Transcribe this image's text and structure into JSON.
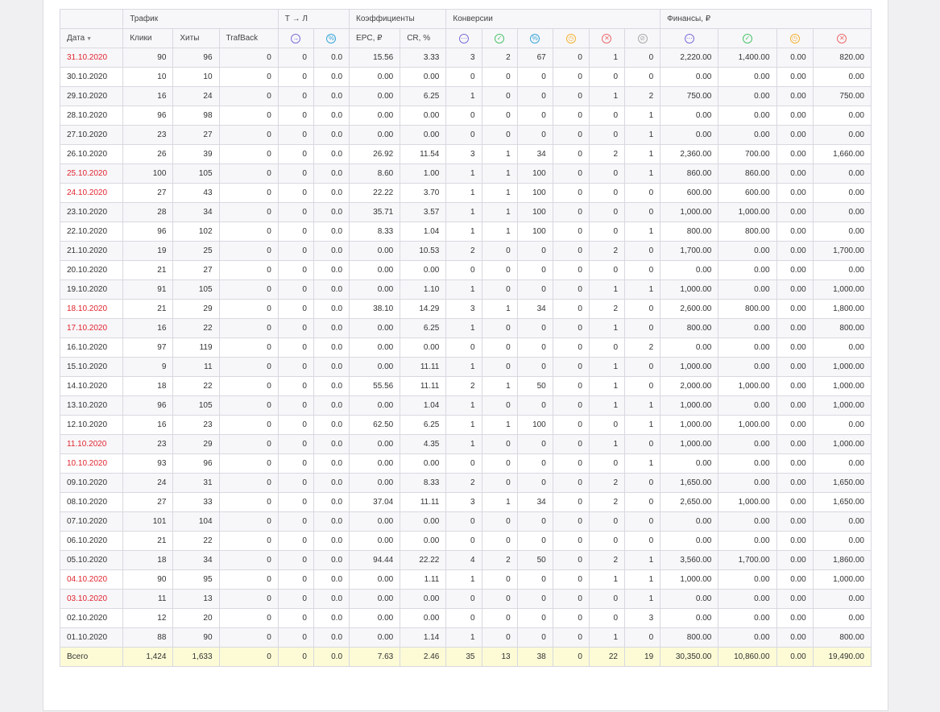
{
  "headers": {
    "groups": {
      "traffic": "Трафик",
      "tl": "Т → Л",
      "coeff": "Коэффициенты",
      "conv": "Конверсии",
      "fin": "Финансы, ₽"
    },
    "columns": {
      "date": "Дата",
      "clicks": "Клики",
      "hits": "Хиты",
      "trafback": "TrafBack",
      "epc": "EPC, ₽",
      "cr": "CR, %"
    },
    "icons": {
      "tl_arrow": "→",
      "tl_percent": "%",
      "conv_all": "⋯",
      "conv_ok": "✓",
      "conv_pct": "%",
      "conv_hold": "◷",
      "conv_rej": "✕",
      "conv_trash": "⊘",
      "fin_all": "⋯",
      "fin_ok": "✓",
      "fin_hold": "◷",
      "fin_rej": "✕"
    }
  },
  "colors": {
    "icon_purple": "#7a6fd6",
    "icon_green": "#4cc36a",
    "icon_blue": "#3ba6d8",
    "icon_orange": "#f5b335",
    "icon_red": "#ec6a6a",
    "icon_gray": "#aaaaaa",
    "date_red": "#e0242e",
    "link_blue": "#3ba6d8",
    "total_bg": "#fcfbd6"
  },
  "rows": [
    {
      "date": "31.10.2020",
      "red": true,
      "clicks": "90",
      "hits": "96",
      "trafback": "0",
      "tl1": "0",
      "tl2": "0.0",
      "epc": "15.56",
      "cr": "3.33",
      "c_all": "3",
      "c_ok": "2",
      "c_pct": "67",
      "c_hold": "0",
      "c_rej": "1",
      "c_trash": "0",
      "f_all": "2,220.00",
      "f_ok": "1,400.00",
      "f_hold": "0.00",
      "f_rej": "820.00"
    },
    {
      "date": "30.10.2020",
      "red": false,
      "clicks": "10",
      "hits": "10",
      "trafback": "0",
      "tl1": "0",
      "tl2": "0.0",
      "epc": "0.00",
      "cr": "0.00",
      "c_all": "0",
      "c_ok": "0",
      "c_pct": "0",
      "c_hold": "0",
      "c_rej": "0",
      "c_trash": "0",
      "f_all": "0.00",
      "f_ok": "0.00",
      "f_hold": "0.00",
      "f_rej": "0.00"
    },
    {
      "date": "29.10.2020",
      "red": false,
      "clicks": "16",
      "hits": "24",
      "trafback": "0",
      "tl1": "0",
      "tl2": "0.0",
      "epc": "0.00",
      "cr": "6.25",
      "c_all": "1",
      "c_ok": "0",
      "c_pct": "0",
      "c_hold": "0",
      "c_rej": "1",
      "c_trash": "2",
      "f_all": "750.00",
      "f_ok": "0.00",
      "f_hold": "0.00",
      "f_rej": "750.00"
    },
    {
      "date": "28.10.2020",
      "red": false,
      "clicks": "96",
      "hits": "98",
      "trafback": "0",
      "tl1": "0",
      "tl2": "0.0",
      "epc": "0.00",
      "cr": "0.00",
      "c_all": "0",
      "c_ok": "0",
      "c_pct": "0",
      "c_hold": "0",
      "c_rej": "0",
      "c_trash": "1",
      "f_all": "0.00",
      "f_ok": "0.00",
      "f_hold": "0.00",
      "f_rej": "0.00"
    },
    {
      "date": "27.10.2020",
      "red": false,
      "clicks": "23",
      "hits": "27",
      "trafback": "0",
      "tl1": "0",
      "tl2": "0.0",
      "epc": "0.00",
      "cr": "0.00",
      "c_all": "0",
      "c_ok": "0",
      "c_pct": "0",
      "c_hold": "0",
      "c_rej": "0",
      "c_trash": "1",
      "f_all": "0.00",
      "f_ok": "0.00",
      "f_hold": "0.00",
      "f_rej": "0.00"
    },
    {
      "date": "26.10.2020",
      "red": false,
      "clicks": "26",
      "hits": "39",
      "trafback": "0",
      "tl1": "0",
      "tl2": "0.0",
      "epc": "26.92",
      "cr": "11.54",
      "c_all": "3",
      "c_ok": "1",
      "c_pct": "34",
      "c_hold": "0",
      "c_rej": "2",
      "c_trash": "1",
      "f_all": "2,360.00",
      "f_ok": "700.00",
      "f_hold": "0.00",
      "f_rej": "1,660.00"
    },
    {
      "date": "25.10.2020",
      "red": true,
      "clicks": "100",
      "hits": "105",
      "trafback": "0",
      "tl1": "0",
      "tl2": "0.0",
      "epc": "8.60",
      "cr": "1.00",
      "c_all": "1",
      "c_ok": "1",
      "c_pct": "100",
      "c_hold": "0",
      "c_rej": "0",
      "c_trash": "1",
      "f_all": "860.00",
      "f_ok": "860.00",
      "f_hold": "0.00",
      "f_rej": "0.00"
    },
    {
      "date": "24.10.2020",
      "red": true,
      "clicks": "27",
      "hits": "43",
      "trafback": "0",
      "tl1": "0",
      "tl2": "0.0",
      "epc": "22.22",
      "cr": "3.70",
      "c_all": "1",
      "c_ok": "1",
      "c_pct": "100",
      "c_hold": "0",
      "c_rej": "0",
      "c_trash": "0",
      "f_all": "600.00",
      "f_ok": "600.00",
      "f_hold": "0.00",
      "f_rej": "0.00"
    },
    {
      "date": "23.10.2020",
      "red": false,
      "clicks": "28",
      "hits": "34",
      "trafback": "0",
      "tl1": "0",
      "tl2": "0.0",
      "epc": "35.71",
      "cr": "3.57",
      "c_all": "1",
      "c_ok": "1",
      "c_pct": "100",
      "c_hold": "0",
      "c_rej": "0",
      "c_trash": "0",
      "f_all": "1,000.00",
      "f_ok": "1,000.00",
      "f_hold": "0.00",
      "f_rej": "0.00"
    },
    {
      "date": "22.10.2020",
      "red": false,
      "clicks": "96",
      "hits": "102",
      "trafback": "0",
      "tl1": "0",
      "tl2": "0.0",
      "epc": "8.33",
      "cr": "1.04",
      "c_all": "1",
      "c_ok": "1",
      "c_pct": "100",
      "c_hold": "0",
      "c_rej": "0",
      "c_trash": "1",
      "f_all": "800.00",
      "f_ok": "800.00",
      "f_hold": "0.00",
      "f_rej": "0.00"
    },
    {
      "date": "21.10.2020",
      "red": false,
      "clicks": "19",
      "hits": "25",
      "trafback": "0",
      "tl1": "0",
      "tl2": "0.0",
      "epc": "0.00",
      "cr": "10.53",
      "c_all": "2",
      "c_ok": "0",
      "c_pct": "0",
      "c_hold": "0",
      "c_rej": "2",
      "c_trash": "0",
      "f_all": "1,700.00",
      "f_ok": "0.00",
      "f_hold": "0.00",
      "f_rej": "1,700.00"
    },
    {
      "date": "20.10.2020",
      "red": false,
      "clicks": "21",
      "hits": "27",
      "trafback": "0",
      "tl1": "0",
      "tl2": "0.0",
      "epc": "0.00",
      "cr": "0.00",
      "c_all": "0",
      "c_ok": "0",
      "c_pct": "0",
      "c_hold": "0",
      "c_rej": "0",
      "c_trash": "0",
      "f_all": "0.00",
      "f_ok": "0.00",
      "f_hold": "0.00",
      "f_rej": "0.00"
    },
    {
      "date": "19.10.2020",
      "red": false,
      "clicks": "91",
      "hits": "105",
      "trafback": "0",
      "tl1": "0",
      "tl2": "0.0",
      "epc": "0.00",
      "cr": "1.10",
      "c_all": "1",
      "c_ok": "0",
      "c_pct": "0",
      "c_hold": "0",
      "c_rej": "1",
      "c_trash": "1",
      "f_all": "1,000.00",
      "f_ok": "0.00",
      "f_hold": "0.00",
      "f_rej": "1,000.00"
    },
    {
      "date": "18.10.2020",
      "red": true,
      "clicks": "21",
      "hits": "29",
      "trafback": "0",
      "tl1": "0",
      "tl2": "0.0",
      "epc": "38.10",
      "cr": "14.29",
      "c_all": "3",
      "c_ok": "1",
      "c_pct": "34",
      "c_hold": "0",
      "c_rej": "2",
      "c_trash": "0",
      "f_all": "2,600.00",
      "f_ok": "800.00",
      "f_hold": "0.00",
      "f_rej": "1,800.00"
    },
    {
      "date": "17.10.2020",
      "red": true,
      "clicks": "16",
      "hits": "22",
      "trafback": "0",
      "tl1": "0",
      "tl2": "0.0",
      "epc": "0.00",
      "cr": "6.25",
      "c_all": "1",
      "c_ok": "0",
      "c_pct": "0",
      "c_hold": "0",
      "c_rej": "1",
      "c_trash": "0",
      "f_all": "800.00",
      "f_ok": "0.00",
      "f_hold": "0.00",
      "f_rej": "800.00"
    },
    {
      "date": "16.10.2020",
      "red": false,
      "clicks": "97",
      "hits": "119",
      "trafback": "0",
      "tl1": "0",
      "tl2": "0.0",
      "epc": "0.00",
      "cr": "0.00",
      "c_all": "0",
      "c_ok": "0",
      "c_pct": "0",
      "c_hold": "0",
      "c_rej": "0",
      "c_trash": "2",
      "f_all": "0.00",
      "f_ok": "0.00",
      "f_hold": "0.00",
      "f_rej": "0.00"
    },
    {
      "date": "15.10.2020",
      "red": false,
      "clicks": "9",
      "hits": "11",
      "trafback": "0",
      "tl1": "0",
      "tl2": "0.0",
      "epc": "0.00",
      "cr": "11.11",
      "c_all": "1",
      "c_ok": "0",
      "c_pct": "0",
      "c_hold": "0",
      "c_rej": "1",
      "c_trash": "0",
      "f_all": "1,000.00",
      "f_ok": "0.00",
      "f_hold": "0.00",
      "f_rej": "1,000.00"
    },
    {
      "date": "14.10.2020",
      "red": false,
      "clicks": "18",
      "hits": "22",
      "trafback": "0",
      "tl1": "0",
      "tl2": "0.0",
      "epc": "55.56",
      "cr": "11.11",
      "c_all": "2",
      "c_ok": "1",
      "c_pct": "50",
      "c_hold": "0",
      "c_rej": "1",
      "c_trash": "0",
      "f_all": "2,000.00",
      "f_ok": "1,000.00",
      "f_hold": "0.00",
      "f_rej": "1,000.00"
    },
    {
      "date": "13.10.2020",
      "red": false,
      "clicks": "96",
      "hits": "105",
      "trafback": "0",
      "tl1": "0",
      "tl2": "0.0",
      "epc": "0.00",
      "cr": "1.04",
      "c_all": "1",
      "c_ok": "0",
      "c_pct": "0",
      "c_hold": "0",
      "c_rej": "1",
      "c_trash": "1",
      "f_all": "1,000.00",
      "f_ok": "0.00",
      "f_hold": "0.00",
      "f_rej": "1,000.00"
    },
    {
      "date": "12.10.2020",
      "red": false,
      "clicks": "16",
      "hits": "23",
      "trafback": "0",
      "tl1": "0",
      "tl2": "0.0",
      "epc": "62.50",
      "cr": "6.25",
      "c_all": "1",
      "c_ok": "1",
      "c_pct": "100",
      "c_hold": "0",
      "c_rej": "0",
      "c_trash": "1",
      "f_all": "1,000.00",
      "f_ok": "1,000.00",
      "f_hold": "0.00",
      "f_rej": "0.00"
    },
    {
      "date": "11.10.2020",
      "red": true,
      "clicks": "23",
      "hits": "29",
      "trafback": "0",
      "tl1": "0",
      "tl2": "0.0",
      "epc": "0.00",
      "cr": "4.35",
      "c_all": "1",
      "c_ok": "0",
      "c_pct": "0",
      "c_hold": "0",
      "c_rej": "1",
      "c_trash": "0",
      "f_all": "1,000.00",
      "f_ok": "0.00",
      "f_hold": "0.00",
      "f_rej": "1,000.00"
    },
    {
      "date": "10.10.2020",
      "red": true,
      "clicks": "93",
      "hits": "96",
      "trafback": "0",
      "tl1": "0",
      "tl2": "0.0",
      "epc": "0.00",
      "cr": "0.00",
      "c_all": "0",
      "c_ok": "0",
      "c_pct": "0",
      "c_hold": "0",
      "c_rej": "0",
      "c_trash": "1",
      "f_all": "0.00",
      "f_ok": "0.00",
      "f_hold": "0.00",
      "f_rej": "0.00"
    },
    {
      "date": "09.10.2020",
      "red": false,
      "clicks": "24",
      "hits": "31",
      "trafback": "0",
      "tl1": "0",
      "tl2": "0.0",
      "epc": "0.00",
      "cr": "8.33",
      "c_all": "2",
      "c_ok": "0",
      "c_pct": "0",
      "c_hold": "0",
      "c_rej": "2",
      "c_trash": "0",
      "f_all": "1,650.00",
      "f_ok": "0.00",
      "f_hold": "0.00",
      "f_rej": "1,650.00"
    },
    {
      "date": "08.10.2020",
      "red": false,
      "clicks": "27",
      "hits": "33",
      "trafback": "0",
      "tl1": "0",
      "tl2": "0.0",
      "epc": "37.04",
      "cr": "11.11",
      "c_all": "3",
      "c_ok": "1",
      "c_pct": "34",
      "c_hold": "0",
      "c_rej": "2",
      "c_trash": "0",
      "f_all": "2,650.00",
      "f_ok": "1,000.00",
      "f_hold": "0.00",
      "f_rej": "1,650.00"
    },
    {
      "date": "07.10.2020",
      "red": false,
      "clicks": "101",
      "hits": "104",
      "trafback": "0",
      "tl1": "0",
      "tl2": "0.0",
      "epc": "0.00",
      "cr": "0.00",
      "c_all": "0",
      "c_ok": "0",
      "c_pct": "0",
      "c_hold": "0",
      "c_rej": "0",
      "c_trash": "0",
      "f_all": "0.00",
      "f_ok": "0.00",
      "f_hold": "0.00",
      "f_rej": "0.00"
    },
    {
      "date": "06.10.2020",
      "red": false,
      "clicks": "21",
      "hits": "22",
      "trafback": "0",
      "tl1": "0",
      "tl2": "0.0",
      "epc": "0.00",
      "cr": "0.00",
      "c_all": "0",
      "c_ok": "0",
      "c_pct": "0",
      "c_hold": "0",
      "c_rej": "0",
      "c_trash": "0",
      "f_all": "0.00",
      "f_ok": "0.00",
      "f_hold": "0.00",
      "f_rej": "0.00"
    },
    {
      "date": "05.10.2020",
      "red": false,
      "clicks": "18",
      "hits": "34",
      "trafback": "0",
      "tl1": "0",
      "tl2": "0.0",
      "epc": "94.44",
      "cr": "22.22",
      "c_all": "4",
      "c_ok": "2",
      "c_pct": "50",
      "c_hold": "0",
      "c_rej": "2",
      "c_trash": "1",
      "f_all": "3,560.00",
      "f_ok": "1,700.00",
      "f_hold": "0.00",
      "f_rej": "1,860.00"
    },
    {
      "date": "04.10.2020",
      "red": true,
      "clicks": "90",
      "hits": "95",
      "trafback": "0",
      "tl1": "0",
      "tl2": "0.0",
      "epc": "0.00",
      "cr": "1.11",
      "c_all": "1",
      "c_ok": "0",
      "c_pct": "0",
      "c_hold": "0",
      "c_rej": "1",
      "c_trash": "1",
      "f_all": "1,000.00",
      "f_ok": "0.00",
      "f_hold": "0.00",
      "f_rej": "1,000.00"
    },
    {
      "date": "03.10.2020",
      "red": true,
      "clicks": "11",
      "hits": "13",
      "trafback": "0",
      "tl1": "0",
      "tl2": "0.0",
      "epc": "0.00",
      "cr": "0.00",
      "c_all": "0",
      "c_ok": "0",
      "c_pct": "0",
      "c_hold": "0",
      "c_rej": "0",
      "c_trash": "1",
      "f_all": "0.00",
      "f_ok": "0.00",
      "f_hold": "0.00",
      "f_rej": "0.00"
    },
    {
      "date": "02.10.2020",
      "red": false,
      "clicks": "12",
      "hits": "20",
      "trafback": "0",
      "tl1": "0",
      "tl2": "0.0",
      "epc": "0.00",
      "cr": "0.00",
      "c_all": "0",
      "c_ok": "0",
      "c_pct": "0",
      "c_hold": "0",
      "c_rej": "0",
      "c_trash": "3",
      "f_all": "0.00",
      "f_ok": "0.00",
      "f_hold": "0.00",
      "f_rej": "0.00"
    },
    {
      "date": "01.10.2020",
      "red": false,
      "clicks": "88",
      "hits": "90",
      "trafback": "0",
      "tl1": "0",
      "tl2": "0.0",
      "epc": "0.00",
      "cr": "1.14",
      "c_all": "1",
      "c_ok": "0",
      "c_pct": "0",
      "c_hold": "0",
      "c_rej": "1",
      "c_trash": "0",
      "f_all": "800.00",
      "f_ok": "0.00",
      "f_hold": "0.00",
      "f_rej": "800.00"
    }
  ],
  "total": {
    "label": "Всего",
    "clicks": "1,424",
    "hits": "1,633",
    "trafback": "0",
    "tl1": "0",
    "tl2": "0.0",
    "epc": "7.63",
    "cr": "2.46",
    "c_all": "35",
    "c_ok": "13",
    "c_pct": "38",
    "c_hold": "0",
    "c_rej": "22",
    "c_trash": "19",
    "f_all": "30,350.00",
    "f_ok": "10,860.00",
    "f_hold": "0.00",
    "f_rej": "19,490.00"
  }
}
